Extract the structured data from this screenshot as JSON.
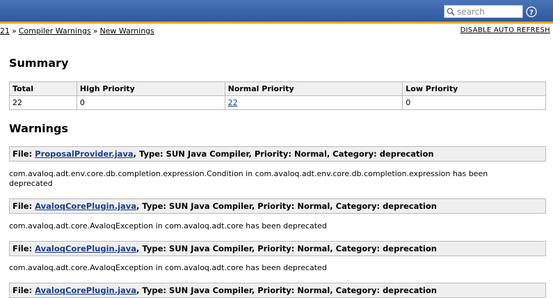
{
  "header": {
    "search": {
      "placeholder": "search",
      "value": ""
    },
    "accent_color": "#f5a623"
  },
  "breadcrumb": {
    "items": [
      "21",
      "Compiler Warnings",
      "New Warnings"
    ],
    "separator": "»"
  },
  "actions": {
    "auto_refresh_label": "DISABLE AUTO REFRESH"
  },
  "summary": {
    "title": "Summary",
    "columns": [
      "Total",
      "High Priority",
      "Normal Priority",
      "Low Priority"
    ],
    "values": [
      "22",
      "0",
      "22",
      "0"
    ]
  },
  "warnings": {
    "title": "Warnings",
    "type_label": "Type:",
    "priority_label": "Priority:",
    "category_label": "Category:",
    "file_label": "File:",
    "items": [
      {
        "file": "ProposalProvider.java",
        "type": "SUN Java Compiler",
        "priority": "Normal",
        "category": "deprecation",
        "message": "com.avaloq.adt.env.core.db.completion.expression.Condition in com.avaloq.adt.env.core.db.completion.expression has been deprecated"
      },
      {
        "file": "AvaloqCorePlugin.java",
        "type": "SUN Java Compiler",
        "priority": "Normal",
        "category": "deprecation",
        "message": "com.avaloq.adt.core.AvaloqException in com.avaloq.adt.core has been deprecated"
      },
      {
        "file": "AvaloqCorePlugin.java",
        "type": "SUN Java Compiler",
        "priority": "Normal",
        "category": "deprecation",
        "message": "com.avaloq.adt.core.AvaloqException in com.avaloq.adt.core has been deprecated"
      },
      {
        "file": "AvaloqCorePlugin.java",
        "type": "SUN Java Compiler",
        "priority": "Normal",
        "category": "deprecation",
        "message": ""
      }
    ]
  }
}
